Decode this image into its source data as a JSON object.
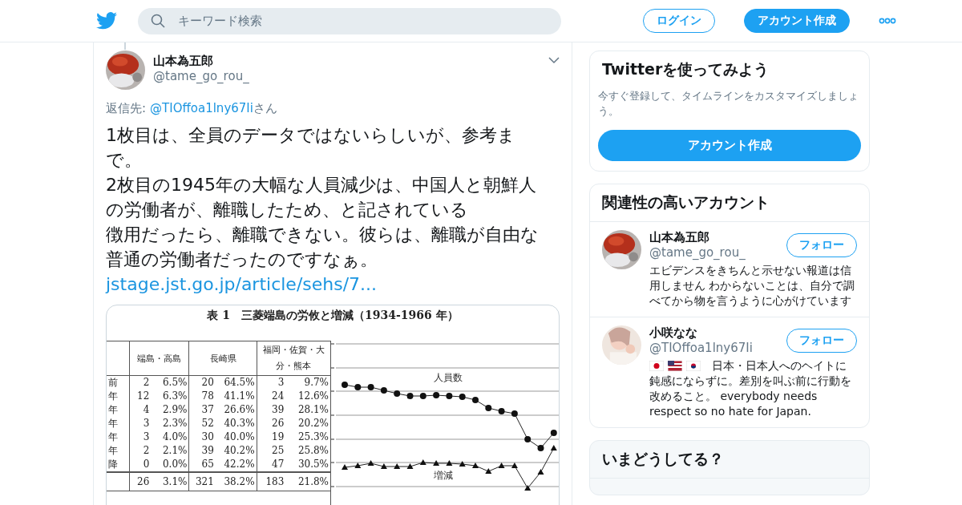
{
  "header": {
    "search": {
      "placeholder": "キーワード検索"
    },
    "buttons": [
      {
        "label": "ログイン",
        "kind": "outline"
      },
      {
        "label": "アカウント作成",
        "kind": "filled"
      }
    ]
  },
  "tweet": {
    "name": "山本為五郎",
    "handle": "@tame_go_rou_",
    "reply_label": "返信先:",
    "reply_handle": "@TIOffoa1lny67Ii",
    "reply_suffix": "さん",
    "paragraphs": [
      "1枚目は、全員のデータではないらしいが、参考まで。",
      "2枚目の1945年の大幅な人員減少は、中国人と朝鮮人の労働者が、離職したため、と記されている",
      "徴用だったら、離職できない。彼らは、離職が自由な普通の労働者だったのですなぁ。"
    ],
    "link": "jstage.jst.go.jp/article/sehs/7...",
    "document": {
      "title": "表 1　三菱端島の労攸と増減（1934-1966 年）",
      "headers": [
        "端島・高島",
        "長崎県",
        "福岡・佐賀・大分・熊本"
      ],
      "rows": [
        {
          "label": "前",
          "cells": [
            "2",
            "6.5%",
            "20",
            "64.5%",
            "3",
            "9.7%"
          ]
        },
        {
          "label": "年",
          "cells": [
            "12",
            "6.3%",
            "78",
            "41.1%",
            "24",
            "12.6%"
          ]
        },
        {
          "label": "年",
          "cells": [
            "4",
            "2.9%",
            "37",
            "26.6%",
            "39",
            "28.1%"
          ]
        },
        {
          "label": "年",
          "cells": [
            "3",
            "2.3%",
            "52",
            "40.3%",
            "26",
            "20.2%"
          ]
        },
        {
          "label": "年",
          "cells": [
            "3",
            "4.0%",
            "30",
            "40.0%",
            "19",
            "25.3%"
          ]
        },
        {
          "label": "年",
          "cells": [
            "2",
            "2.1%",
            "39",
            "40.2%",
            "25",
            "25.8%"
          ]
        },
        {
          "label": "降",
          "cells": [
            "0",
            "0.0%",
            "65",
            "42.2%",
            "47",
            "30.5%"
          ]
        }
      ],
      "total": [
        "26",
        "3.1%",
        "321",
        "38.2%",
        "183",
        "21.8%"
      ],
      "series_labels": [
        "人員数",
        "増減"
      ]
    }
  },
  "sidebar": {
    "signup": {
      "title": "Twitterを使ってみよう",
      "text": "今すぐ登録して、タイムラインをカスタマイズしましょう。",
      "button": "アカウント作成"
    },
    "related": {
      "title": "関連性の高いアカウント",
      "accounts": [
        {
          "name": "山本為五郎",
          "handle": "@tame_go_rou_",
          "button": "フォロー",
          "bio": "エビデンスをきちんと示せない報道は信用しません わからないことは、自分で調べてから物を言うように心がけています",
          "flags": false
        },
        {
          "name": "小咲なな",
          "handle": "@TIOffoa1lny67Ii",
          "button": "フォロー",
          "bio_lead": "日本・日本人へのヘイトに",
          "bio": "鈍感にならずに。差別を叫ぶ前に行動を改めること。 everybody needs respect so no hate for Japan.",
          "flags": true
        }
      ]
    },
    "trends": {
      "title": "いまどうしてる？"
    }
  }
}
